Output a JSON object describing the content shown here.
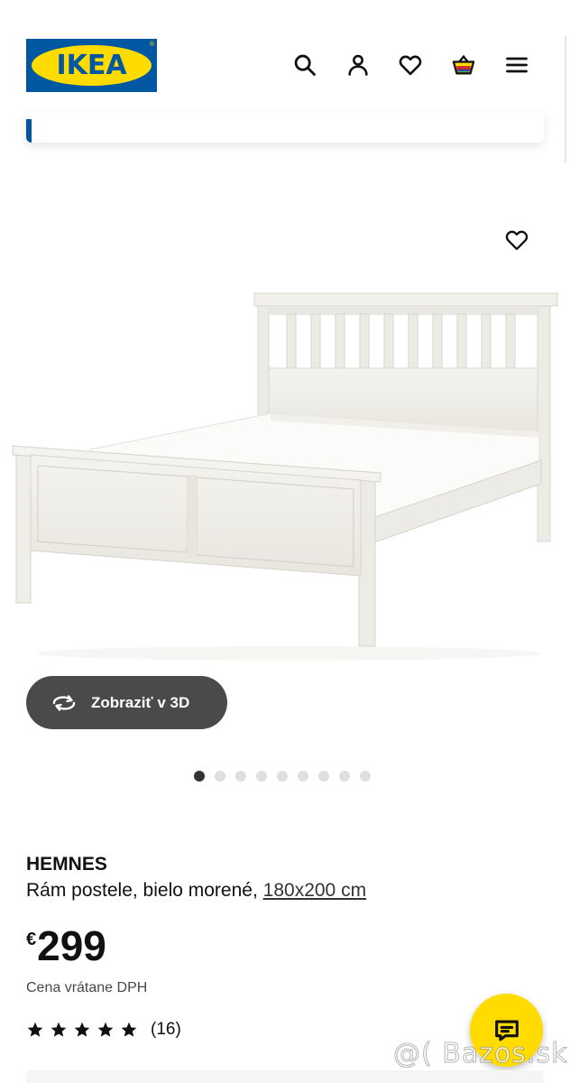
{
  "header": {
    "logo_text": "IKEA",
    "brand_colors": {
      "blue": "#0058a3",
      "yellow": "#ffdb00"
    },
    "icons": [
      "search-icon",
      "user-icon",
      "heart-icon",
      "basket-icon",
      "menu-icon"
    ]
  },
  "product": {
    "view_3d_label": "Zobraziť v 3D",
    "image_count": 9,
    "active_image_index": 0,
    "name": "HEMNES",
    "description": "Rám postele, bielo morené,",
    "size_link": "180x200 cm",
    "currency": "€",
    "price": "299",
    "vat_note": "Cena vrátane DPH",
    "rating_stars": 5,
    "rating_count": "(16)"
  },
  "watermark": "@( Bazos.sk"
}
